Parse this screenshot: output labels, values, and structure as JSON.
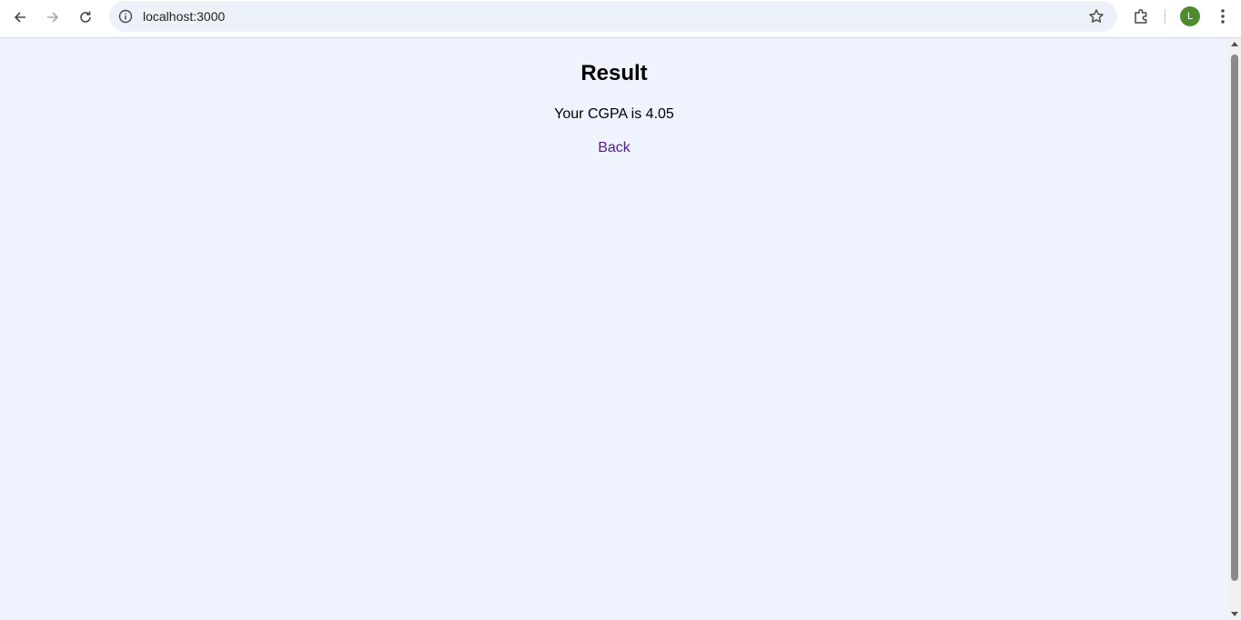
{
  "browser": {
    "url": "localhost:3000",
    "profile_initial": "L",
    "profile_color": "#4f8b2e",
    "icons": [
      "back-arrow-icon",
      "forward-arrow-icon",
      "reload-icon",
      "info-icon",
      "star-icon",
      "extensions-icon",
      "kebab-menu-icon"
    ]
  },
  "page": {
    "title": "Result",
    "result_text": "Your CGPA is 4.05",
    "back_link": "Back",
    "background_color": "#eef3fd",
    "link_color": "#551a8b"
  }
}
